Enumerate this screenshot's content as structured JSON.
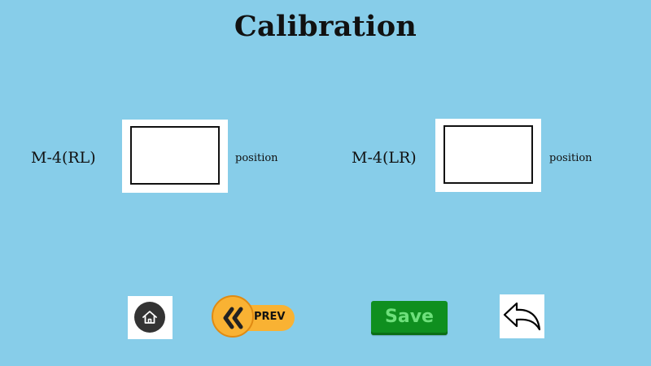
{
  "page": {
    "title": "Calibration"
  },
  "fields": [
    {
      "label": "M-4(RL)",
      "value": "",
      "suffix": "position"
    },
    {
      "label": "M-4(LR)",
      "value": "",
      "suffix": "position"
    }
  ],
  "nav": {
    "home_icon": "home-icon",
    "prev_label": "PREV",
    "prev_icon": "double-chevron-left-icon",
    "save_label": "Save",
    "back_icon": "undo-arrow-icon"
  },
  "colors": {
    "background": "#87CDE9",
    "prev_accent": "#F9B233",
    "save_green": "#0F8F1F",
    "save_text": "#6EE07B"
  }
}
